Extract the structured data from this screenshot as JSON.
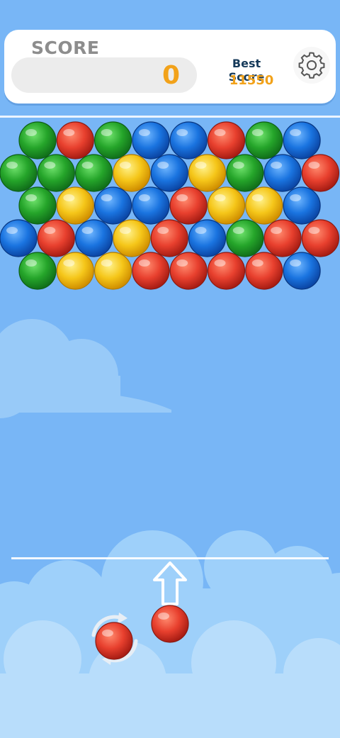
{
  "header": {
    "score_label": "SCORE",
    "score_value": "0",
    "best_label": "Best Score",
    "best_value": "11550",
    "settings_icon": "gear-icon"
  },
  "colors": {
    "green": "#25a52a",
    "red": "#e8402e",
    "blue": "#1a74e0",
    "yellow": "#f5c619",
    "score_accent": "#f2a21a",
    "sky": "#78b6f6"
  },
  "board": {
    "rows": [
      [
        "green",
        "red",
        "green",
        "blue",
        "blue",
        "red",
        "green",
        "blue"
      ],
      [
        "green",
        "green",
        "green",
        "yellow",
        "blue",
        "yellow",
        "green",
        "blue",
        "red"
      ],
      [
        "green",
        "yellow",
        "blue",
        "blue",
        "red",
        "yellow",
        "yellow",
        "blue"
      ],
      [
        "blue",
        "red",
        "blue",
        "yellow",
        "red",
        "blue",
        "green",
        "red",
        "red"
      ],
      [
        "green",
        "yellow",
        "yellow",
        "red",
        "red",
        "red",
        "red",
        "blue"
      ]
    ]
  },
  "shooter": {
    "current_bubble": "red",
    "next_bubble": "red",
    "aim_icon": "up-arrow-icon",
    "swap_icon": "swap-arrows-icon"
  }
}
